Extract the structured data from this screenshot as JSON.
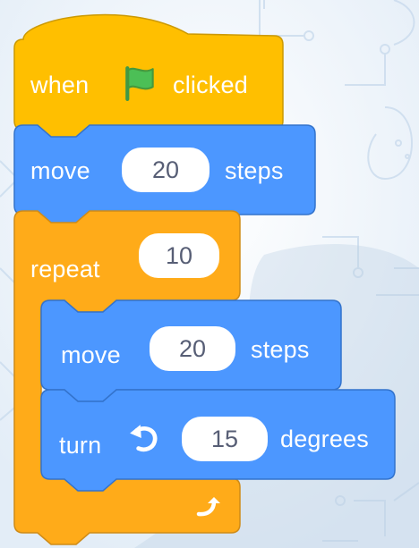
{
  "colors": {
    "event_block": "#ffbf00",
    "event_block_edge": "#cc9900",
    "motion_block": "#4c97ff",
    "motion_block_edge": "#3373cc",
    "control_block": "#ffab19",
    "control_block_edge": "#cf8b17",
    "flag_green": "#4cbf56",
    "input_text": "#575e75"
  },
  "icons": {
    "flag": "green-flag-icon",
    "turn": "rotate-left-icon",
    "loop_arrow": "loop-arrow-icon"
  },
  "script": {
    "hat": {
      "word_before": "when",
      "word_after": "clicked"
    },
    "move_1": {
      "label": "move",
      "value": "20",
      "unit": "steps"
    },
    "repeat": {
      "label": "repeat",
      "value": "10"
    },
    "move_2": {
      "label": "move",
      "value": "20",
      "unit": "steps"
    },
    "turn": {
      "label": "turn",
      "value": "15",
      "unit": "degrees"
    }
  }
}
